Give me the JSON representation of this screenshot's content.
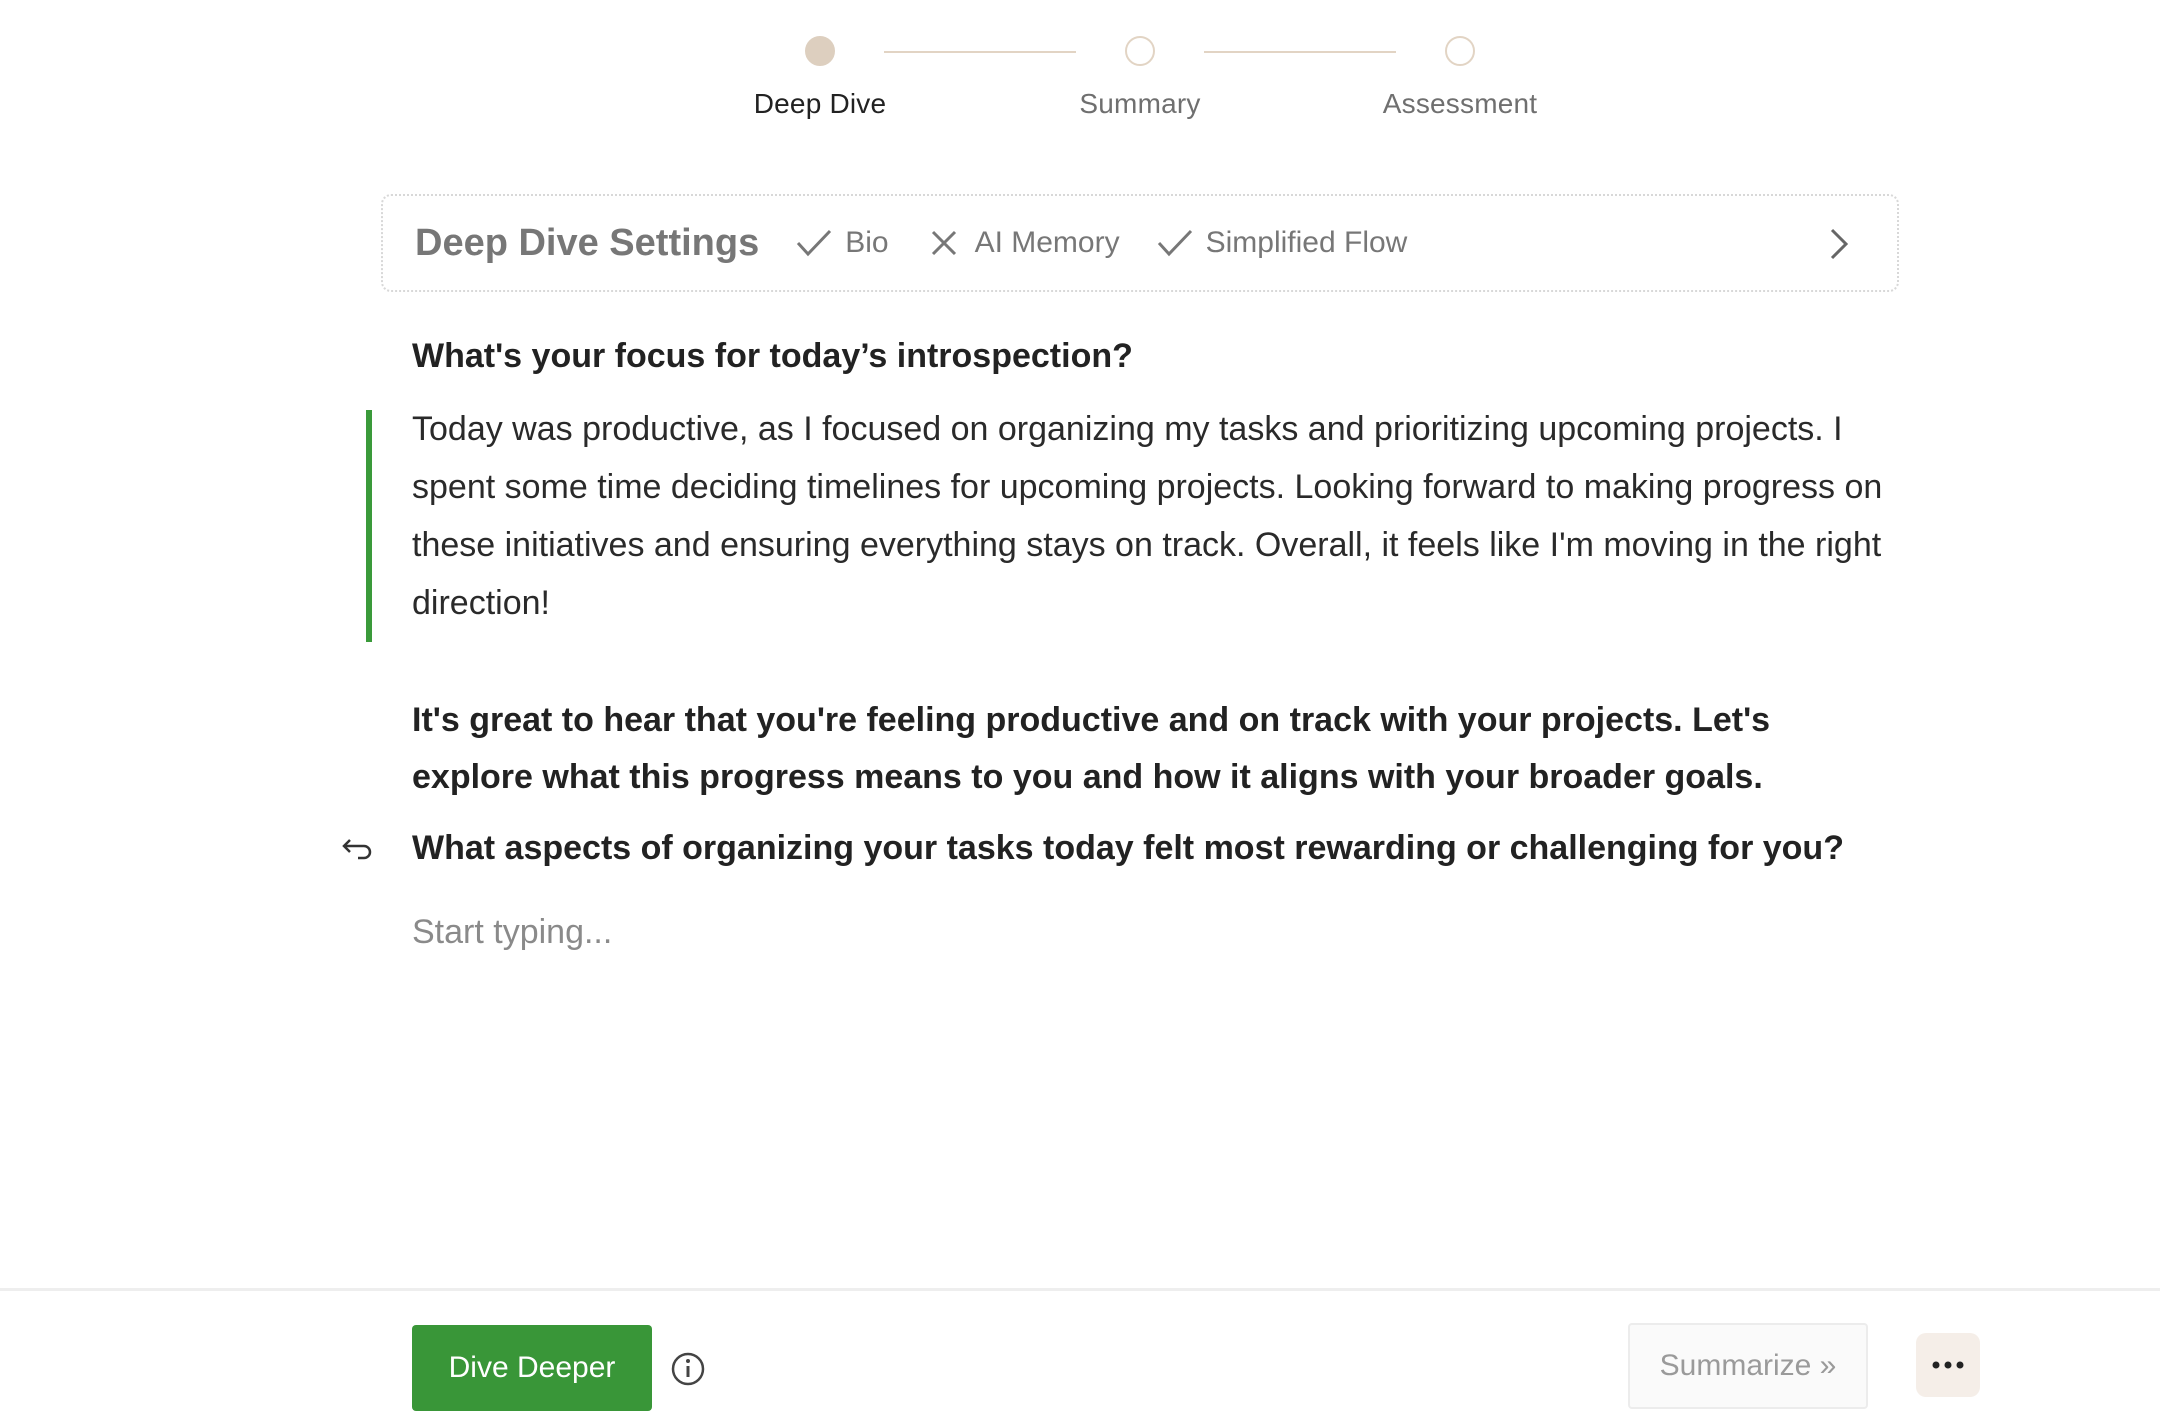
{
  "stepper": {
    "steps": [
      {
        "label": "Deep Dive",
        "state": "active"
      },
      {
        "label": "Summary",
        "state": "pending"
      },
      {
        "label": "Assessment",
        "state": "pending"
      }
    ]
  },
  "settings": {
    "title": "Deep Dive Settings",
    "options": [
      {
        "label": "Bio",
        "icon": "check-icon",
        "enabled": true
      },
      {
        "label": "AI Memory",
        "icon": "x-icon",
        "enabled": false
      },
      {
        "label": "Simplified Flow",
        "icon": "check-icon",
        "enabled": true
      }
    ],
    "expand_icon": "chevron-right-icon"
  },
  "conversation": {
    "question": "What's your focus for today’s introspection?",
    "answer": "Today was productive, as I focused on organizing my tasks and prioritizing upcoming projects. I spent some time deciding timelines for upcoming projects. Looking forward to making progress on these initiatives and ensuring everything stays on track. Overall, it feels like I'm moving in the right direction!",
    "ai_response": "It's great to hear that you're feeling productive and on track with your projects. Let's explore what this progress means to you and how it aligns with your broader goals.",
    "followup_question": "What aspects of organizing your tasks today felt most rewarding or challenging for you?",
    "reply_icon": "reply-icon"
  },
  "input": {
    "value": "",
    "placeholder": "Start typing..."
  },
  "footer": {
    "dive_deeper_label": "Dive Deeper",
    "info_icon": "info-icon",
    "summarize_label": "Summarize »",
    "more_icon": "more-icon"
  },
  "colors": {
    "accent_green": "#399638",
    "answer_bar": "#3a9a3a",
    "stepper_active": "#ddcfbf",
    "stepper_line": "#e2d4c4",
    "more_button_bg": "#f5eee8"
  }
}
